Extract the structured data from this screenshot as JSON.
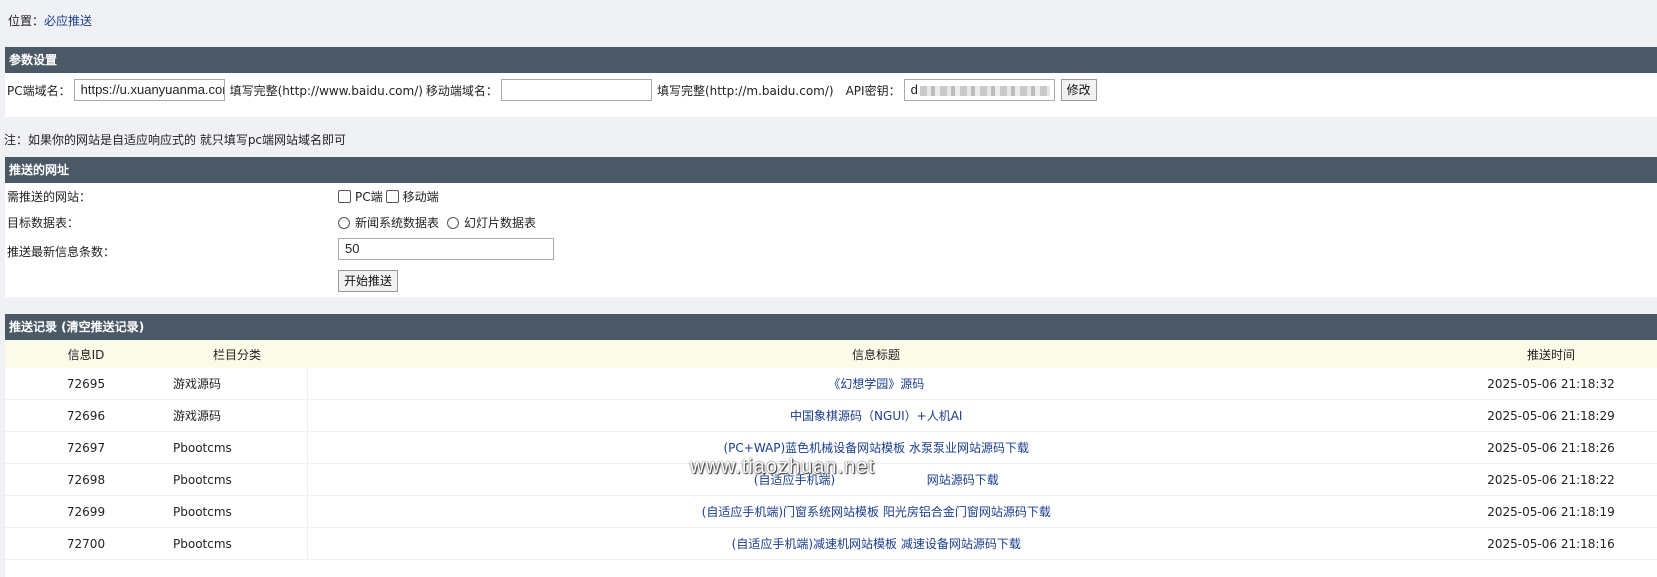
{
  "breadcrumb": {
    "label": "位置：",
    "link": "必应推送"
  },
  "params": {
    "header": "参数设置",
    "pc_label": "PC端域名：",
    "pc_value": "https://u.xuanyuanma.com/",
    "pc_hint": "填写完整(http://www.baidu.com/)",
    "mobile_label": "移动端域名：",
    "mobile_value": "",
    "mobile_hint": "填写完整(http://m.baidu.com/)",
    "api_label": "API密钥：",
    "api_value": "d",
    "modify_button": "修改"
  },
  "note": "注：如果你的网站是自适应响应式的 就只填写pc端网站域名即可",
  "push": {
    "header": "推送的网址",
    "sites_label": "需推送的网站：",
    "opt_pc": "PC端",
    "opt_mobile": "移动端",
    "table_label": "目标数据表：",
    "opt_news": "新闻系统数据表",
    "opt_slides": "幻灯片数据表",
    "count_label": "推送最新信息条数：",
    "count_value": "50",
    "start_button": "开始推送"
  },
  "records": {
    "header_prefix": "推送记录 (",
    "clear_link": "清空推送记录",
    "header_suffix": ")",
    "columns": [
      "信息ID",
      "栏目分类",
      "信息标题",
      "推送时间"
    ],
    "rows": [
      {
        "id": "72695",
        "cat": "游戏源码",
        "title": "《幻想学园》源码",
        "time": "2025-05-06 21:18:32"
      },
      {
        "id": "72696",
        "cat": "游戏源码",
        "title": "中国象棋源码（NGUI）+人机AI",
        "time": "2025-05-06 21:18:29"
      },
      {
        "id": "72697",
        "cat": "Pbootcms",
        "title": "(PC+WAP)蓝色机械设备网站模板 水泵泵业网站源码下载",
        "time": "2025-05-06 21:18:26"
      },
      {
        "id": "72698",
        "cat": "Pbootcms",
        "title": "(自适应手机端)                        网站源码下载",
        "time": "2025-05-06 21:18:22"
      },
      {
        "id": "72699",
        "cat": "Pbootcms",
        "title": "(自适应手机端)门窗系统网站模板 阳光房铝合金门窗网站源码下载",
        "time": "2025-05-06 21:18:19"
      },
      {
        "id": "72700",
        "cat": "Pbootcms",
        "title": "(自适应手机端)减速机网站模板 减速设备网站源码下载",
        "time": "2025-05-06 21:18:16"
      }
    ]
  },
  "watermark": "www.tiaozhuan.net"
}
